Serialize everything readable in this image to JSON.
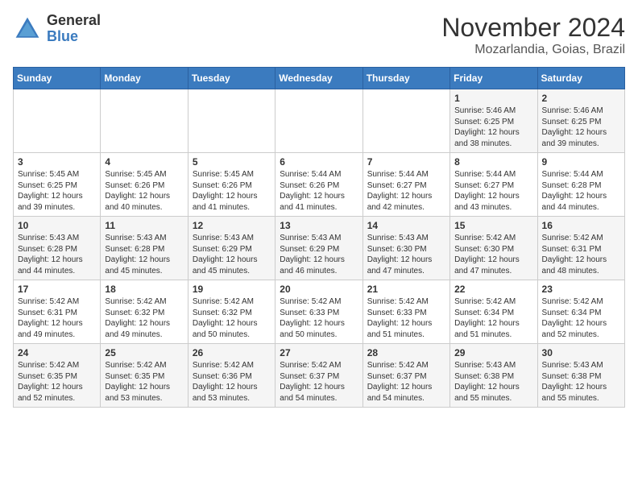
{
  "header": {
    "logo": {
      "general": "General",
      "blue": "Blue"
    },
    "title": "November 2024",
    "location": "Mozarlandia, Goias, Brazil"
  },
  "calendar": {
    "days_of_week": [
      "Sunday",
      "Monday",
      "Tuesday",
      "Wednesday",
      "Thursday",
      "Friday",
      "Saturday"
    ],
    "weeks": [
      [
        {
          "day": "",
          "info": ""
        },
        {
          "day": "",
          "info": ""
        },
        {
          "day": "",
          "info": ""
        },
        {
          "day": "",
          "info": ""
        },
        {
          "day": "",
          "info": ""
        },
        {
          "day": "1",
          "info": "Sunrise: 5:46 AM\nSunset: 6:25 PM\nDaylight: 12 hours\nand 38 minutes."
        },
        {
          "day": "2",
          "info": "Sunrise: 5:46 AM\nSunset: 6:25 PM\nDaylight: 12 hours\nand 39 minutes."
        }
      ],
      [
        {
          "day": "3",
          "info": "Sunrise: 5:45 AM\nSunset: 6:25 PM\nDaylight: 12 hours\nand 39 minutes."
        },
        {
          "day": "4",
          "info": "Sunrise: 5:45 AM\nSunset: 6:26 PM\nDaylight: 12 hours\nand 40 minutes."
        },
        {
          "day": "5",
          "info": "Sunrise: 5:45 AM\nSunset: 6:26 PM\nDaylight: 12 hours\nand 41 minutes."
        },
        {
          "day": "6",
          "info": "Sunrise: 5:44 AM\nSunset: 6:26 PM\nDaylight: 12 hours\nand 41 minutes."
        },
        {
          "day": "7",
          "info": "Sunrise: 5:44 AM\nSunset: 6:27 PM\nDaylight: 12 hours\nand 42 minutes."
        },
        {
          "day": "8",
          "info": "Sunrise: 5:44 AM\nSunset: 6:27 PM\nDaylight: 12 hours\nand 43 minutes."
        },
        {
          "day": "9",
          "info": "Sunrise: 5:44 AM\nSunset: 6:28 PM\nDaylight: 12 hours\nand 44 minutes."
        }
      ],
      [
        {
          "day": "10",
          "info": "Sunrise: 5:43 AM\nSunset: 6:28 PM\nDaylight: 12 hours\nand 44 minutes."
        },
        {
          "day": "11",
          "info": "Sunrise: 5:43 AM\nSunset: 6:28 PM\nDaylight: 12 hours\nand 45 minutes."
        },
        {
          "day": "12",
          "info": "Sunrise: 5:43 AM\nSunset: 6:29 PM\nDaylight: 12 hours\nand 45 minutes."
        },
        {
          "day": "13",
          "info": "Sunrise: 5:43 AM\nSunset: 6:29 PM\nDaylight: 12 hours\nand 46 minutes."
        },
        {
          "day": "14",
          "info": "Sunrise: 5:43 AM\nSunset: 6:30 PM\nDaylight: 12 hours\nand 47 minutes."
        },
        {
          "day": "15",
          "info": "Sunrise: 5:42 AM\nSunset: 6:30 PM\nDaylight: 12 hours\nand 47 minutes."
        },
        {
          "day": "16",
          "info": "Sunrise: 5:42 AM\nSunset: 6:31 PM\nDaylight: 12 hours\nand 48 minutes."
        }
      ],
      [
        {
          "day": "17",
          "info": "Sunrise: 5:42 AM\nSunset: 6:31 PM\nDaylight: 12 hours\nand 49 minutes."
        },
        {
          "day": "18",
          "info": "Sunrise: 5:42 AM\nSunset: 6:32 PM\nDaylight: 12 hours\nand 49 minutes."
        },
        {
          "day": "19",
          "info": "Sunrise: 5:42 AM\nSunset: 6:32 PM\nDaylight: 12 hours\nand 50 minutes."
        },
        {
          "day": "20",
          "info": "Sunrise: 5:42 AM\nSunset: 6:33 PM\nDaylight: 12 hours\nand 50 minutes."
        },
        {
          "day": "21",
          "info": "Sunrise: 5:42 AM\nSunset: 6:33 PM\nDaylight: 12 hours\nand 51 minutes."
        },
        {
          "day": "22",
          "info": "Sunrise: 5:42 AM\nSunset: 6:34 PM\nDaylight: 12 hours\nand 51 minutes."
        },
        {
          "day": "23",
          "info": "Sunrise: 5:42 AM\nSunset: 6:34 PM\nDaylight: 12 hours\nand 52 minutes."
        }
      ],
      [
        {
          "day": "24",
          "info": "Sunrise: 5:42 AM\nSunset: 6:35 PM\nDaylight: 12 hours\nand 52 minutes."
        },
        {
          "day": "25",
          "info": "Sunrise: 5:42 AM\nSunset: 6:35 PM\nDaylight: 12 hours\nand 53 minutes."
        },
        {
          "day": "26",
          "info": "Sunrise: 5:42 AM\nSunset: 6:36 PM\nDaylight: 12 hours\nand 53 minutes."
        },
        {
          "day": "27",
          "info": "Sunrise: 5:42 AM\nSunset: 6:37 PM\nDaylight: 12 hours\nand 54 minutes."
        },
        {
          "day": "28",
          "info": "Sunrise: 5:42 AM\nSunset: 6:37 PM\nDaylight: 12 hours\nand 54 minutes."
        },
        {
          "day": "29",
          "info": "Sunrise: 5:43 AM\nSunset: 6:38 PM\nDaylight: 12 hours\nand 55 minutes."
        },
        {
          "day": "30",
          "info": "Sunrise: 5:43 AM\nSunset: 6:38 PM\nDaylight: 12 hours\nand 55 minutes."
        }
      ]
    ]
  }
}
